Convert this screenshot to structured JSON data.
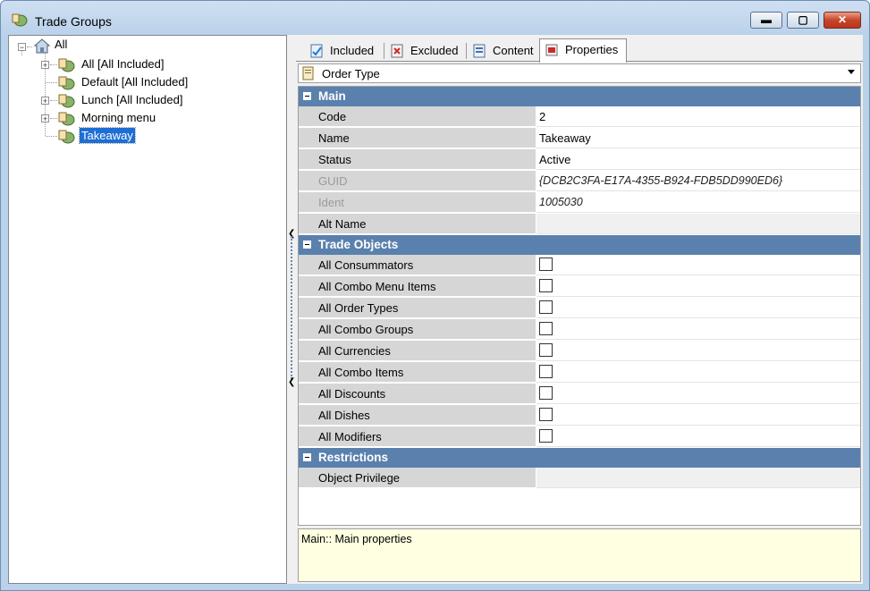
{
  "window": {
    "title": "Trade Groups",
    "min_label": "▬",
    "max_label": "▢",
    "close_label": "✕"
  },
  "tree": {
    "root": "All",
    "children": [
      {
        "label": "All [All Included]",
        "expander": "+"
      },
      {
        "label": "Default [All Included]",
        "expander": ""
      },
      {
        "label": "Lunch [All Included]",
        "expander": "+"
      },
      {
        "label": "Morning menu",
        "expander": "+"
      },
      {
        "label": "Takeaway",
        "expander": "",
        "selected": true
      }
    ]
  },
  "tabs": [
    {
      "label": "Included",
      "icon": "check-document-icon"
    },
    {
      "label": "Excluded",
      "icon": "x-document-icon"
    },
    {
      "label": "Content",
      "icon": "content-document-icon"
    },
    {
      "label": "Properties",
      "icon": "properties-icon",
      "active": true
    }
  ],
  "selector": {
    "value": "Order Type"
  },
  "properties": {
    "main": {
      "title": "Main",
      "rows": [
        {
          "name": "Code",
          "value": "2"
        },
        {
          "name": "Name",
          "value": "Takeaway"
        },
        {
          "name": "Status",
          "value": "Active"
        },
        {
          "name": "GUID",
          "value": "{DCB2C3FA-E17A-4355-B924-FDB5DD990ED6}"
        },
        {
          "name": "Ident",
          "value": "1005030"
        },
        {
          "name": "Alt Name",
          "value": ""
        }
      ]
    },
    "trade_objects": {
      "title": "Trade Objects",
      "rows": [
        {
          "name": "All Consummators",
          "checked": false
        },
        {
          "name": "All Combo Menu Items",
          "checked": false
        },
        {
          "name": "All Order Types",
          "checked": false
        },
        {
          "name": "All Combo Groups",
          "checked": false
        },
        {
          "name": "All Currencies",
          "checked": false
        },
        {
          "name": "All Combo Items",
          "checked": false
        },
        {
          "name": "All Discounts",
          "checked": false
        },
        {
          "name": "All Dishes",
          "checked": false
        },
        {
          "name": "All Modifiers",
          "checked": false
        }
      ]
    },
    "restrictions": {
      "title": "Restrictions",
      "rows": [
        {
          "name": "Object Privilege",
          "value": ""
        }
      ]
    }
  },
  "description": "Main:: Main properties",
  "colors": {
    "category_header": "#5a80ad",
    "selection": "#1d6fd4",
    "description_bg": "#ffffe1"
  }
}
